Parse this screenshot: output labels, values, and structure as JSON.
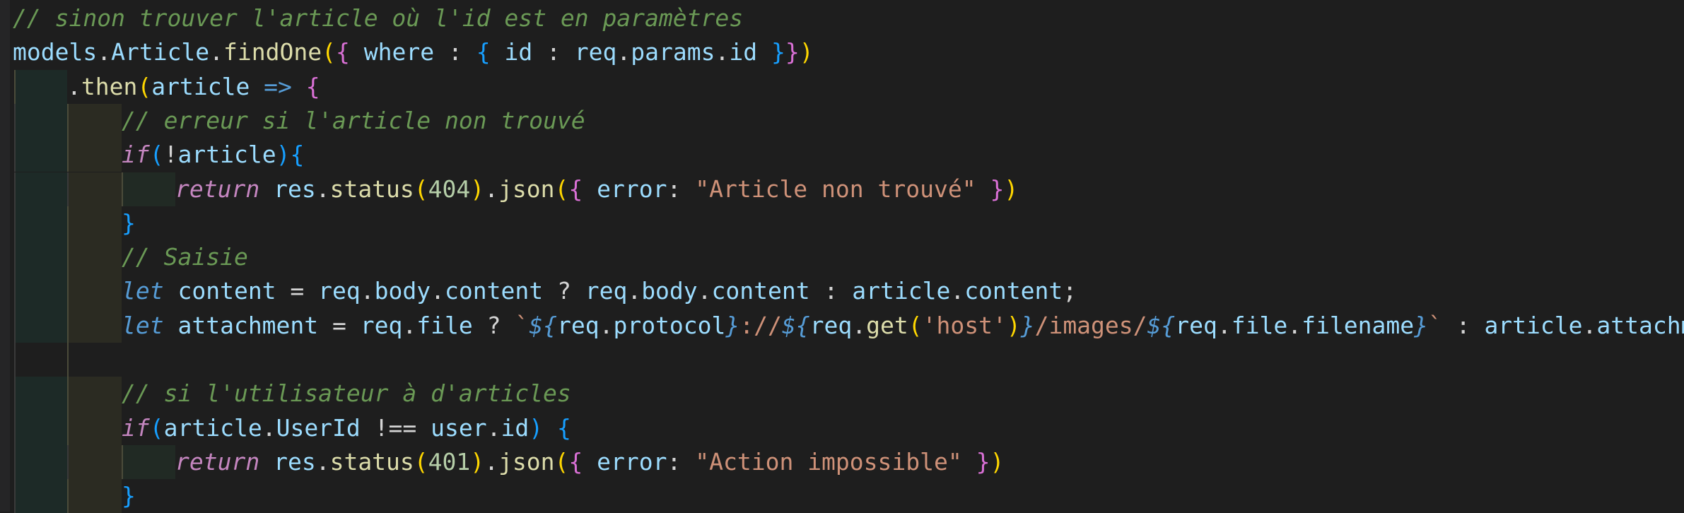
{
  "editor": {
    "language": "javascript",
    "theme_colors": {
      "background": "#1e1e1e",
      "comment": "#6a9955",
      "variable": "#9cdcfe",
      "function": "#dcdcaa",
      "keyword": "#c586c0",
      "declaration": "#569cd6",
      "number": "#b5cea8",
      "string": "#ce9178",
      "bracket_gold": "#ffd700",
      "bracket_orchid": "#da70d6",
      "bracket_blue": "#179fff"
    },
    "lines": [
      {
        "tokens": [
          {
            "t": "// sinon trouver l'article où l'id est en paramètres",
            "c": "c-comment"
          }
        ]
      },
      {
        "tokens": [
          {
            "t": "models",
            "c": "c-var"
          },
          {
            "t": ".",
            "c": "c-punct"
          },
          {
            "t": "Article",
            "c": "c-var"
          },
          {
            "t": ".",
            "c": "c-punct"
          },
          {
            "t": "findOne",
            "c": "c-fn"
          },
          {
            "t": "(",
            "c": "b1"
          },
          {
            "t": "{",
            "c": "b2"
          },
          {
            "t": " where",
            "c": "c-var"
          },
          {
            "t": " : ",
            "c": "c-op"
          },
          {
            "t": "{",
            "c": "b3"
          },
          {
            "t": " id",
            "c": "c-var"
          },
          {
            "t": " : ",
            "c": "c-op"
          },
          {
            "t": "req",
            "c": "c-var"
          },
          {
            "t": ".",
            "c": "c-punct"
          },
          {
            "t": "params",
            "c": "c-var"
          },
          {
            "t": ".",
            "c": "c-punct"
          },
          {
            "t": "id ",
            "c": "c-var"
          },
          {
            "t": "}",
            "c": "b3"
          },
          {
            "t": "}",
            "c": "b2"
          },
          {
            "t": ")",
            "c": "b1"
          }
        ]
      },
      {
        "tokens": [
          {
            "t": ".",
            "c": "c-punct"
          },
          {
            "t": "then",
            "c": "c-fn"
          },
          {
            "t": "(",
            "c": "b1"
          },
          {
            "t": "article",
            "c": "c-var"
          },
          {
            "t": " => ",
            "c": "c-arrow"
          },
          {
            "t": "{",
            "c": "b2"
          }
        ]
      },
      {
        "tokens": [
          {
            "t": "// erreur si l'article non trouvé",
            "c": "c-comment"
          }
        ]
      },
      {
        "tokens": [
          {
            "t": "if",
            "c": "c-kw"
          },
          {
            "t": "(",
            "c": "b3"
          },
          {
            "t": "!",
            "c": "c-op"
          },
          {
            "t": "article",
            "c": "c-var"
          },
          {
            "t": ")",
            "c": "b3"
          },
          {
            "t": "{",
            "c": "b3"
          }
        ]
      },
      {
        "tokens": [
          {
            "t": "return",
            "c": "c-kw"
          },
          {
            "t": " res",
            "c": "c-var"
          },
          {
            "t": ".",
            "c": "c-punct"
          },
          {
            "t": "status",
            "c": "c-fn"
          },
          {
            "t": "(",
            "c": "b1"
          },
          {
            "t": "404",
            "c": "c-num"
          },
          {
            "t": ")",
            "c": "b1"
          },
          {
            "t": ".",
            "c": "c-punct"
          },
          {
            "t": "json",
            "c": "c-fn"
          },
          {
            "t": "(",
            "c": "b1"
          },
          {
            "t": "{",
            "c": "b2"
          },
          {
            "t": " error",
            "c": "c-var"
          },
          {
            "t": ": ",
            "c": "c-op"
          },
          {
            "t": "\"Article non trouvé\"",
            "c": "c-str"
          },
          {
            "t": " ",
            "c": "c-op"
          },
          {
            "t": "}",
            "c": "b2"
          },
          {
            "t": ")",
            "c": "b1"
          }
        ]
      },
      {
        "tokens": [
          {
            "t": "}",
            "c": "b3"
          }
        ]
      },
      {
        "tokens": [
          {
            "t": "// Saisie",
            "c": "c-comment"
          }
        ]
      },
      {
        "tokens": [
          {
            "t": "let",
            "c": "c-decl"
          },
          {
            "t": " content",
            "c": "c-var"
          },
          {
            "t": " = ",
            "c": "c-op"
          },
          {
            "t": "req",
            "c": "c-var"
          },
          {
            "t": ".",
            "c": "c-punct"
          },
          {
            "t": "body",
            "c": "c-var"
          },
          {
            "t": ".",
            "c": "c-punct"
          },
          {
            "t": "content",
            "c": "c-var"
          },
          {
            "t": " ? ",
            "c": "c-op"
          },
          {
            "t": "req",
            "c": "c-var"
          },
          {
            "t": ".",
            "c": "c-punct"
          },
          {
            "t": "body",
            "c": "c-var"
          },
          {
            "t": ".",
            "c": "c-punct"
          },
          {
            "t": "content",
            "c": "c-var"
          },
          {
            "t": " : ",
            "c": "c-op"
          },
          {
            "t": "article",
            "c": "c-var"
          },
          {
            "t": ".",
            "c": "c-punct"
          },
          {
            "t": "content",
            "c": "c-var"
          },
          {
            "t": ";",
            "c": "c-punct"
          }
        ]
      },
      {
        "tokens": [
          {
            "t": "let",
            "c": "c-decl"
          },
          {
            "t": " attachment",
            "c": "c-var"
          },
          {
            "t": " = ",
            "c": "c-op"
          },
          {
            "t": "req",
            "c": "c-var"
          },
          {
            "t": ".",
            "c": "c-punct"
          },
          {
            "t": "file",
            "c": "c-var"
          },
          {
            "t": " ? ",
            "c": "c-op"
          },
          {
            "t": "`",
            "c": "c-str"
          },
          {
            "t": "${",
            "c": "c-decl"
          },
          {
            "t": "req",
            "c": "c-var"
          },
          {
            "t": ".",
            "c": "c-punct"
          },
          {
            "t": "protocol",
            "c": "c-var"
          },
          {
            "t": "}",
            "c": "c-decl"
          },
          {
            "t": "://",
            "c": "c-str"
          },
          {
            "t": "${",
            "c": "c-decl"
          },
          {
            "t": "req",
            "c": "c-var"
          },
          {
            "t": ".",
            "c": "c-punct"
          },
          {
            "t": "get",
            "c": "c-fn"
          },
          {
            "t": "(",
            "c": "b1"
          },
          {
            "t": "'host'",
            "c": "c-str"
          },
          {
            "t": ")",
            "c": "b1"
          },
          {
            "t": "}",
            "c": "c-decl"
          },
          {
            "t": "/images/",
            "c": "c-str"
          },
          {
            "t": "${",
            "c": "c-decl"
          },
          {
            "t": "req",
            "c": "c-var"
          },
          {
            "t": ".",
            "c": "c-punct"
          },
          {
            "t": "file",
            "c": "c-var"
          },
          {
            "t": ".",
            "c": "c-punct"
          },
          {
            "t": "filename",
            "c": "c-var"
          },
          {
            "t": "}",
            "c": "c-decl"
          },
          {
            "t": "`",
            "c": "c-str"
          },
          {
            "t": " : ",
            "c": "c-op"
          },
          {
            "t": "article",
            "c": "c-var"
          },
          {
            "t": ".",
            "c": "c-punct"
          },
          {
            "t": "attachment",
            "c": "c-var"
          },
          {
            "t": ";",
            "c": "c-punct"
          }
        ]
      },
      {
        "tokens": []
      },
      {
        "tokens": [
          {
            "t": "// si l'utilisateur à d'articles",
            "c": "c-comment"
          }
        ]
      },
      {
        "tokens": [
          {
            "t": "if",
            "c": "c-kw"
          },
          {
            "t": "(",
            "c": "b3"
          },
          {
            "t": "article",
            "c": "c-var"
          },
          {
            "t": ".",
            "c": "c-punct"
          },
          {
            "t": "UserId",
            "c": "c-var"
          },
          {
            "t": " !== ",
            "c": "c-op"
          },
          {
            "t": "user",
            "c": "c-var"
          },
          {
            "t": ".",
            "c": "c-punct"
          },
          {
            "t": "id",
            "c": "c-var"
          },
          {
            "t": ")",
            "c": "b3"
          },
          {
            "t": " ",
            "c": "c-op"
          },
          {
            "t": "{",
            "c": "b3"
          }
        ]
      },
      {
        "tokens": [
          {
            "t": "return",
            "c": "c-kw"
          },
          {
            "t": " res",
            "c": "c-var"
          },
          {
            "t": ".",
            "c": "c-punct"
          },
          {
            "t": "status",
            "c": "c-fn"
          },
          {
            "t": "(",
            "c": "b1"
          },
          {
            "t": "401",
            "c": "c-num"
          },
          {
            "t": ")",
            "c": "b1"
          },
          {
            "t": ".",
            "c": "c-punct"
          },
          {
            "t": "json",
            "c": "c-fn"
          },
          {
            "t": "(",
            "c": "b1"
          },
          {
            "t": "{",
            "c": "b2"
          },
          {
            "t": " error",
            "c": "c-var"
          },
          {
            "t": ": ",
            "c": "c-op"
          },
          {
            "t": "\"Action impossible\"",
            "c": "c-str"
          },
          {
            "t": " ",
            "c": "c-op"
          },
          {
            "t": "}",
            "c": "b2"
          },
          {
            "t": ")",
            "c": "b1"
          }
        ]
      },
      {
        "tokens": [
          {
            "t": "}",
            "c": "b3"
          }
        ]
      }
    ]
  }
}
